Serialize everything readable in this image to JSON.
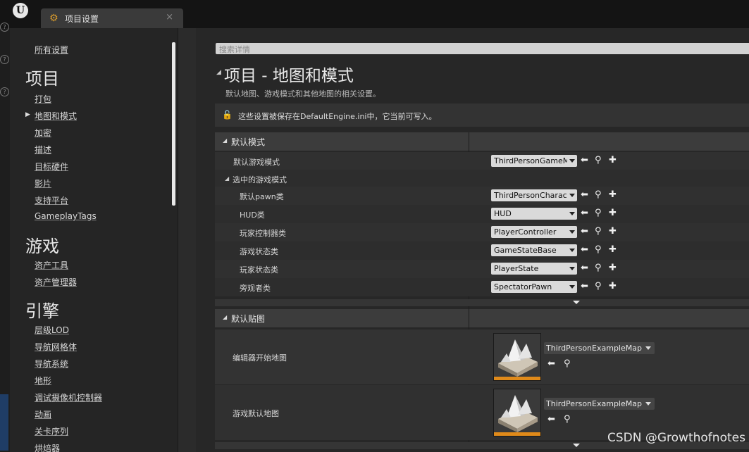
{
  "window": {
    "logo": "U",
    "tab_title": "项目设置",
    "tab_close": "×"
  },
  "sidebar": {
    "all_settings": "所有设置",
    "cat_project": "项目",
    "project_items": [
      "打包",
      "地图和模式",
      "加密",
      "描述",
      "目标硬件",
      "影片",
      "支持平台",
      "GameplayTags"
    ],
    "selected_item": "地图和模式",
    "cat_game": "游戏",
    "game_items": [
      "资产工具",
      "资产管理器"
    ],
    "cat_engine": "引擎",
    "engine_items": [
      "层级LOD",
      "导航网格体",
      "导航系统",
      "地形",
      "调试摄像机控制器",
      "动画",
      "关卡序列",
      "烘焙器"
    ]
  },
  "main": {
    "search_placeholder": "搜索详情",
    "title": "项目 - 地图和模式",
    "subtitle": "默认地图、游戏模式和其他地图的相关设置。",
    "notice": "这些设置被保存在DefaultEngine.ini中，它当前可写入。",
    "default_modes": {
      "header": "默认模式",
      "game_mode_label": "默认游戏模式",
      "game_mode_value": "ThirdPersonGameMode",
      "selected_group": "选中的游戏模式",
      "rows": [
        {
          "label": "默认pawn类",
          "value": "ThirdPersonCharacter"
        },
        {
          "label": "HUD类",
          "value": "HUD"
        },
        {
          "label": "玩家控制器类",
          "value": "PlayerController"
        },
        {
          "label": "游戏状态类",
          "value": "GameStateBase"
        },
        {
          "label": "玩家状态类",
          "value": "PlayerState"
        },
        {
          "label": "旁观者类",
          "value": "SpectatorPawn"
        }
      ]
    },
    "default_maps": {
      "header": "默认贴图",
      "rows": [
        {
          "label": "编辑器开始地图",
          "value": "ThirdPersonExampleMap"
        },
        {
          "label": "游戏默认地图",
          "value": "ThirdPersonExampleMap"
        }
      ]
    }
  },
  "icons": {
    "reset": "arrow-left-icon",
    "browse": "search-icon",
    "add": "plus-icon",
    "lock": "unlock-icon"
  },
  "watermark": "CSDN @Growthofnotes"
}
